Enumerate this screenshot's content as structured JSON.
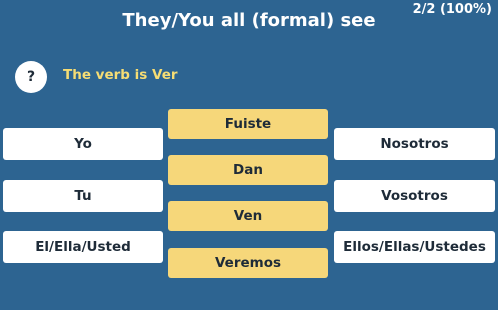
{
  "header": {
    "title": "They/You all (formal) see",
    "progress": "2/2 (100%)"
  },
  "hint": {
    "icon_label": "?",
    "text": "The verb is Ver"
  },
  "left_slots": [
    "Yo",
    "Tu",
    "El/Ella/Usted"
  ],
  "right_slots": [
    "Nosotros",
    "Vosotros",
    "Ellos/Ellas/Ustedes"
  ],
  "options": [
    "Fuiste",
    "Dan",
    "Ven",
    "Veremos"
  ],
  "colors": {
    "background": "#2d6491",
    "option": "#f6d77a",
    "hint_text": "#f6dd74",
    "slot": "#ffffff"
  }
}
